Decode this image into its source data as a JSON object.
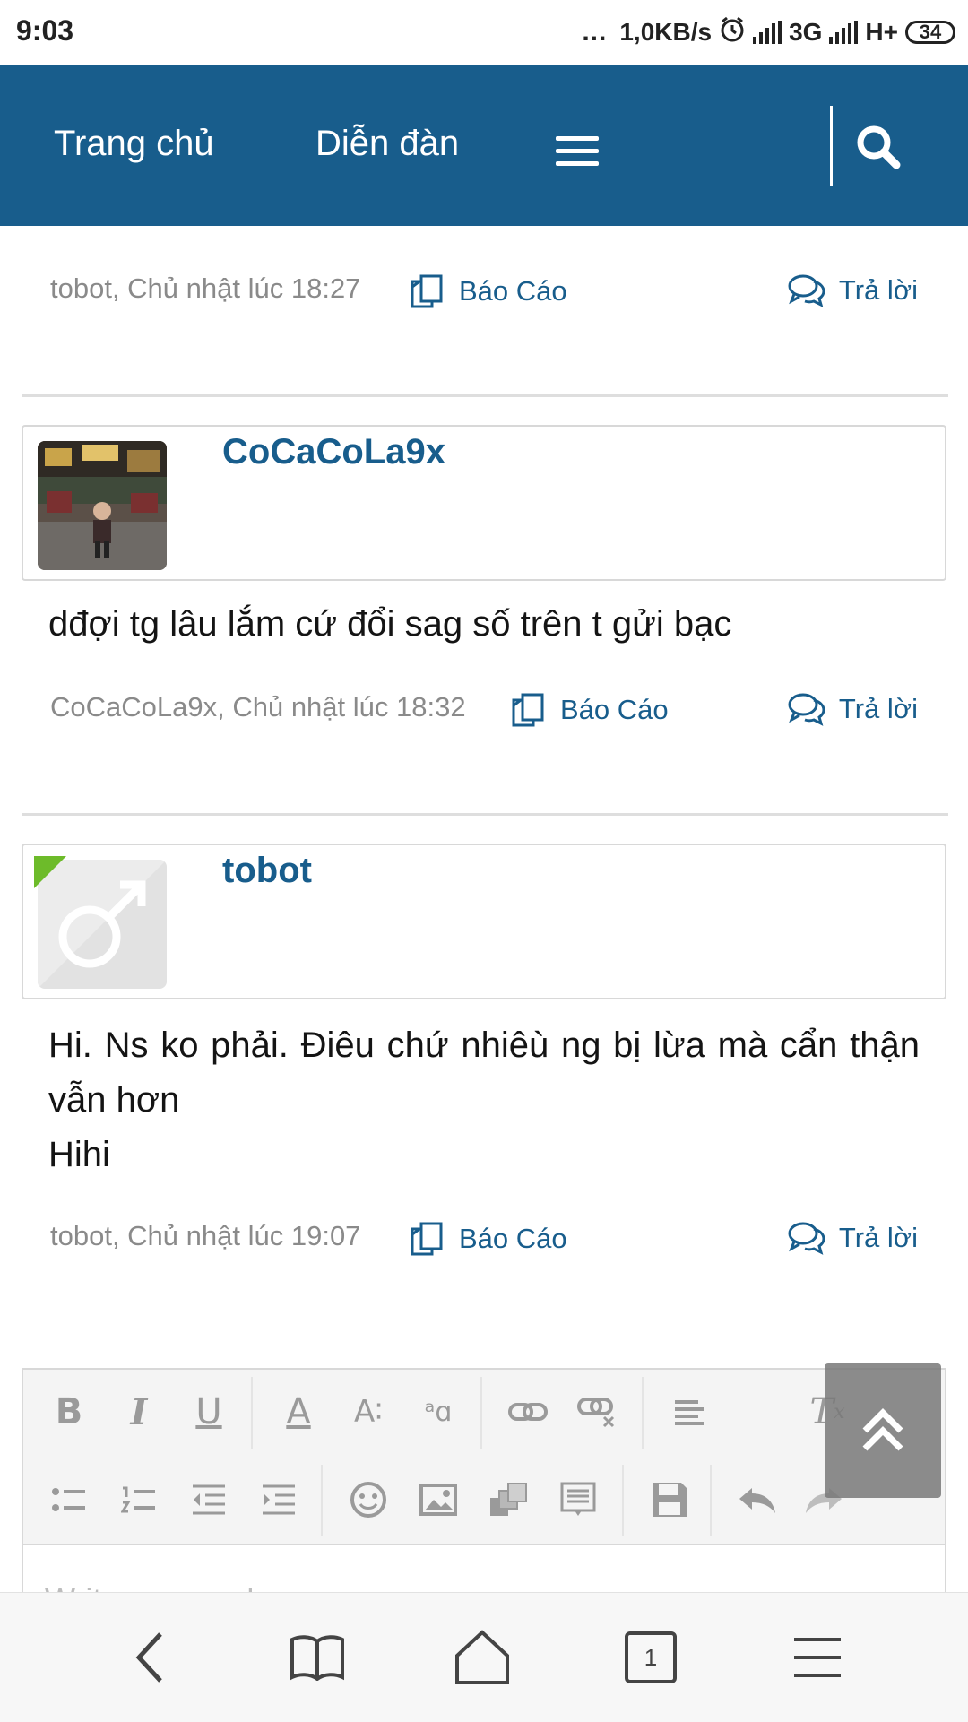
{
  "status_bar": {
    "time": "9:03",
    "dots": "...",
    "speed": "1,0KB/s",
    "network_1": "3G",
    "network_2": "H+",
    "battery": "34"
  },
  "nav": {
    "home_label": "Trang chủ",
    "forum_label": "Diễn đàn"
  },
  "posts": [
    {
      "meta": "tobot, Chủ nhật lúc 18:27",
      "report_label": "Báo Cáo",
      "reply_label": "Trả lời"
    },
    {
      "username": "CoCaCoLa9x",
      "body": "dđợi tg lâu lắm cứ đổi sag số trên t gửi bạc",
      "meta": "CoCaCoLa9x, Chủ nhật lúc 18:32",
      "report_label": "Báo Cáo",
      "reply_label": "Trả lời"
    },
    {
      "username": "tobot",
      "body_line1": "Hi. Ns ko phải. Điêu chứ nhiêù ng bị lừa mà cẩn thận vẫn hơn",
      "body_line2": "Hihi",
      "meta": "tobot, Chủ nhật lúc 19:07",
      "report_label": "Báo Cáo",
      "reply_label": "Trả lời"
    }
  ],
  "editor": {
    "placeholder": "Write your reply..."
  },
  "bottom_bar": {
    "tab_count": "1"
  },
  "colors": {
    "brand": "#185d8c",
    "meta_text": "#8a8a8a"
  }
}
